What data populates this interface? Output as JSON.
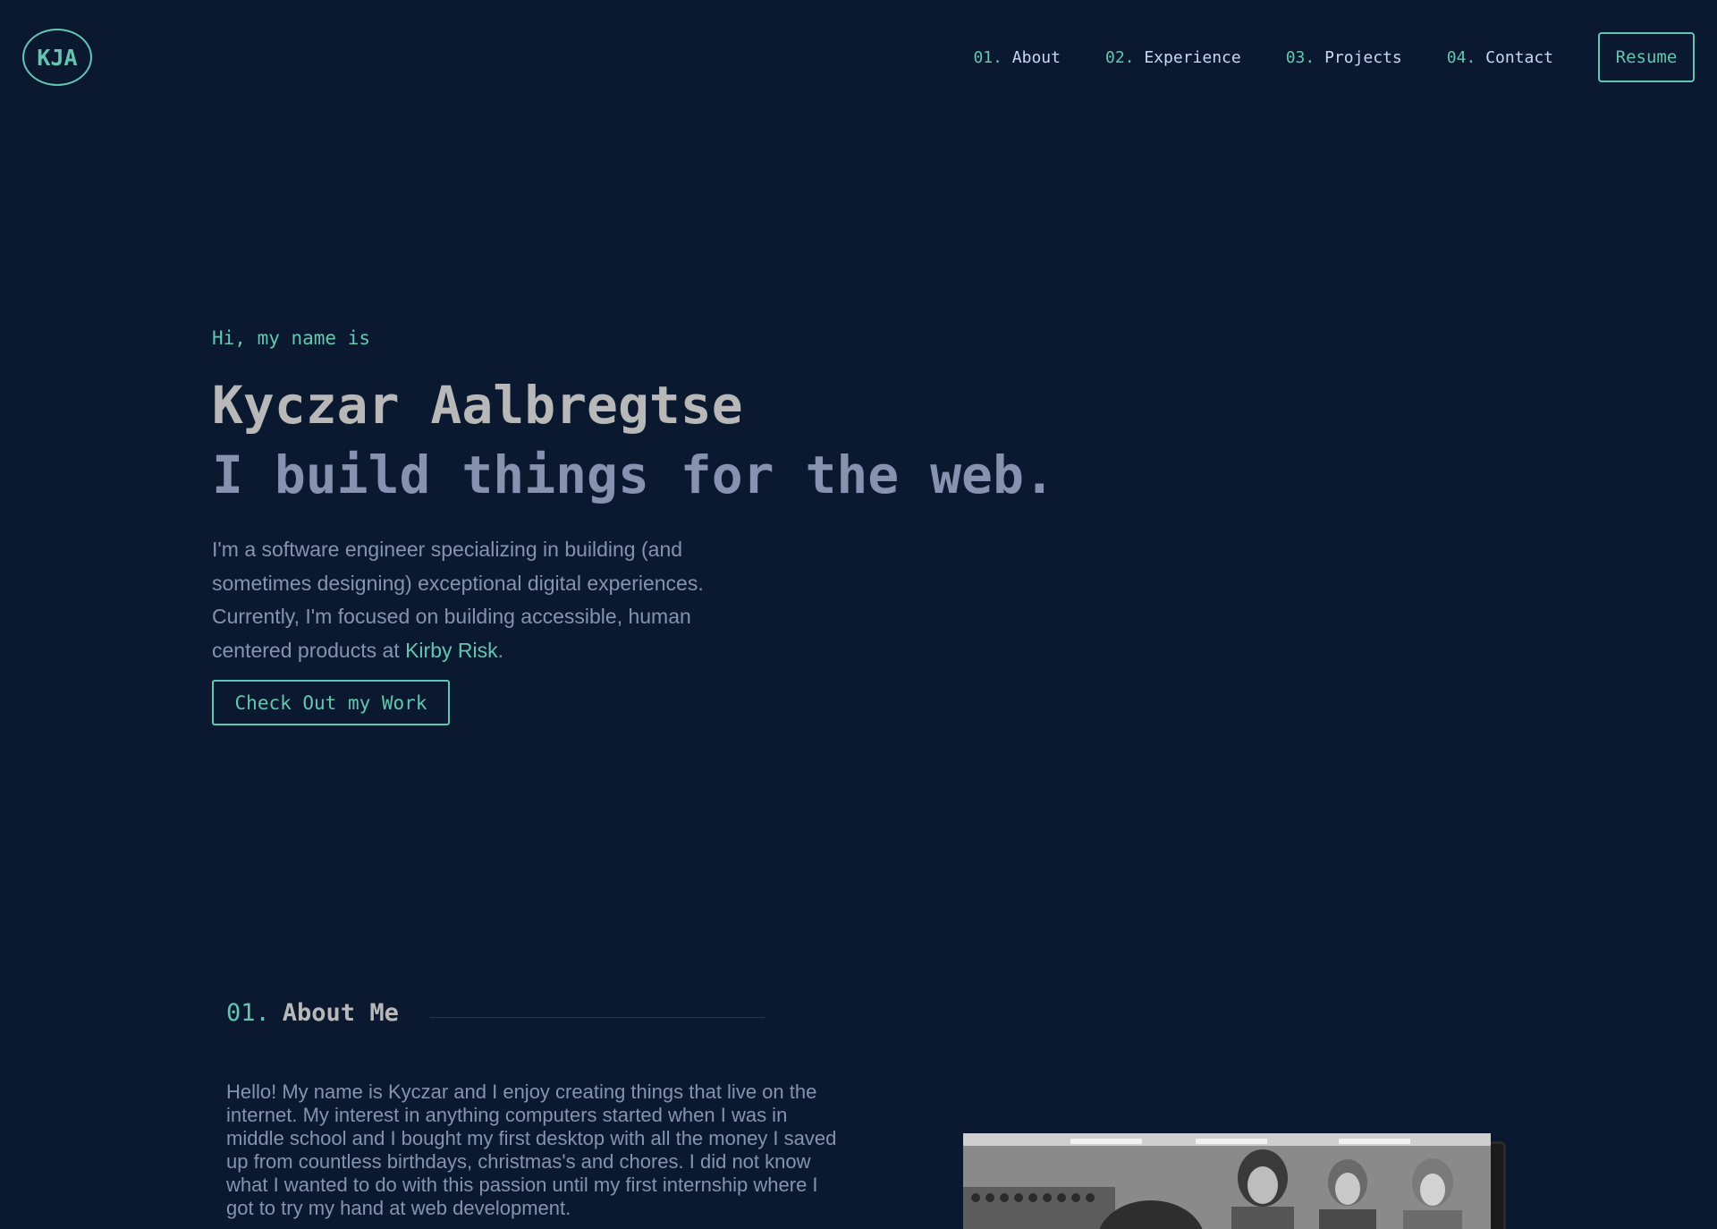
{
  "logo": {
    "text": "KJA"
  },
  "nav": {
    "items": [
      {
        "num": "01.",
        "label": "About"
      },
      {
        "num": "02.",
        "label": "Experience"
      },
      {
        "num": "03.",
        "label": "Projects"
      },
      {
        "num": "04.",
        "label": "Contact"
      }
    ],
    "resume_label": "Resume"
  },
  "hero": {
    "intro": "Hi, my name is",
    "name": "Kyczar Aalbregtse",
    "tagline": "I build things for the web.",
    "description_before_link": "I'm a software engineer specializing in building (and sometimes designing) exceptional digital experiences. Currently, I'm focused on building accessible, human centered products at ",
    "company_link": "Kirby Risk",
    "description_after_link": ".",
    "cta_label": "Check Out my Work"
  },
  "about": {
    "num": "01.",
    "title": "About Me",
    "paragraph": "Hello! My name is Kyczar and I enjoy creating things that live on the internet. My interest in anything computers started when I was in middle school and I bought my first desktop with all the money I saved up from countless birthdays, christmas's and chores. I did not know what I wanted to do with this passion until my first internship where I got to try my hand at web development."
  },
  "colors": {
    "background": "#0a192f",
    "accent": "#64c5b1",
    "text_primary": "#ccd6f6",
    "text_secondary": "#8892b0",
    "heading": "#b8b8b8"
  }
}
